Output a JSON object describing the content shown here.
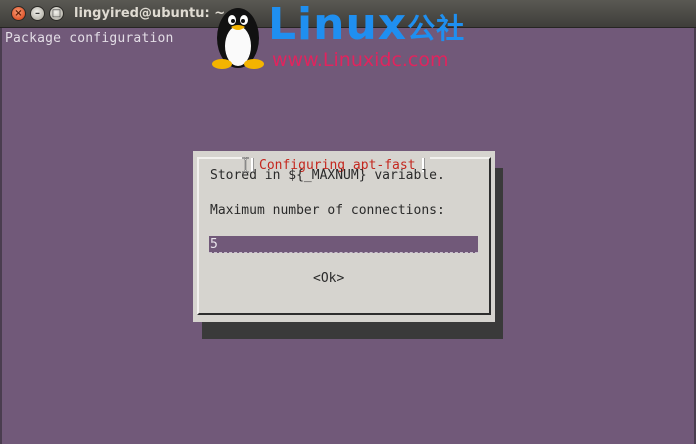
{
  "window": {
    "title": "lingyired@ubuntu: ~",
    "controls": {
      "close": "close-icon",
      "minimize": "minimize-icon",
      "maximize": "maximize-icon"
    }
  },
  "terminal": {
    "header_text": "Package configuration",
    "background_color": "#715979"
  },
  "watermark": {
    "logo_text": "Linux",
    "logo_suffix": "公社",
    "url": "www.Linuxidc.com",
    "icon": "tux-penguin-icon"
  },
  "dialog": {
    "title": "Configuring apt-fast",
    "description_line": "Stored in ${_MAXNUM} variable.",
    "prompt": "Maximum number of connections:",
    "input_value": "5",
    "ok_label": "<Ok>",
    "title_color": "#c4271e"
  }
}
